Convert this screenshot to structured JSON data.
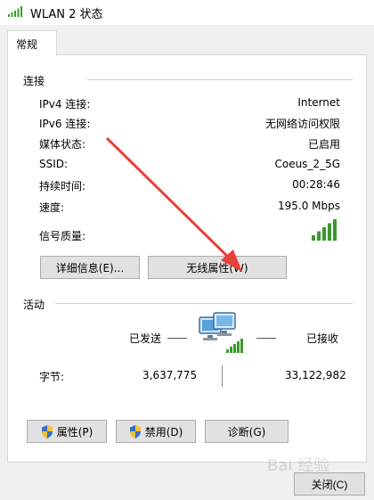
{
  "window": {
    "title": "WLAN 2 状态"
  },
  "tabs": [
    {
      "label": "常规"
    }
  ],
  "connection": {
    "header": "连接",
    "rows": [
      {
        "label": "IPv4 连接:",
        "value": "Internet"
      },
      {
        "label": "IPv6 连接:",
        "value": "无网络访问权限"
      },
      {
        "label": "媒体状态:",
        "value": "已启用"
      },
      {
        "label": "SSID:",
        "value": "Coeus_2_5G"
      },
      {
        "label": "持续时间:",
        "value": "00:28:46"
      },
      {
        "label": "速度:",
        "value": "195.0 Mbps"
      }
    ],
    "signal_label": "信号质量:",
    "signal_bars": 5,
    "signal_color": "#3a9a2b"
  },
  "buttons": {
    "details": "详细信息(E)...",
    "wireless_props": "无线属性(W)"
  },
  "activity": {
    "header": "活动",
    "sent_label": "已发送",
    "received_label": "已接收",
    "bytes_label": "字节:",
    "bytes_sent": "3,637,775",
    "bytes_received": "33,122,982"
  },
  "bottom_buttons": {
    "properties": "属性(P)",
    "disable": "禁用(D)",
    "diagnose": "诊断(G)"
  },
  "close_label": "关闭(C)",
  "watermark": "Bai 经验",
  "annotation_arrow_color": "#e8413b"
}
